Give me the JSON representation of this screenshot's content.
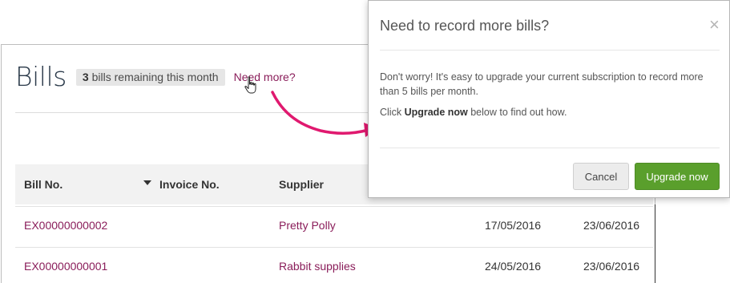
{
  "page": {
    "title": "Bills",
    "remaining_count": "3",
    "remaining_text": "bills remaining this month",
    "need_more_link": "Need more?"
  },
  "table": {
    "columns": [
      "Bill No.",
      "Invoice No.",
      "Supplier"
    ],
    "rows": [
      {
        "bill_no": "EX00000000002",
        "invoice_no": "",
        "supplier": "Pretty Polly",
        "date": "17/05/2016",
        "due_date": "23/06/2016"
      },
      {
        "bill_no": "EX00000000001",
        "invoice_no": "",
        "supplier": "Rabbit supplies",
        "date": "24/05/2016",
        "due_date": "23/06/2016"
      }
    ]
  },
  "modal": {
    "title": "Need to record more bills?",
    "close_symbol": "×",
    "body_line1": "Don't worry! It's easy to upgrade your current subscription to record more than 5 bills per month.",
    "body_line2_prefix": "Click ",
    "body_line2_bold": "Upgrade now",
    "body_line2_suffix": " below to find out how.",
    "cancel_label": "Cancel",
    "upgrade_label": "Upgrade now"
  },
  "colors": {
    "link": "#8a1d5a",
    "arrow": "#e0196f",
    "upgrade_button": "#5a9f2c",
    "badge_bg": "#e6e6e6"
  },
  "icons": {
    "cursor": "hand-pointer-icon",
    "sort": "sort-down-icon",
    "close": "close-icon"
  }
}
